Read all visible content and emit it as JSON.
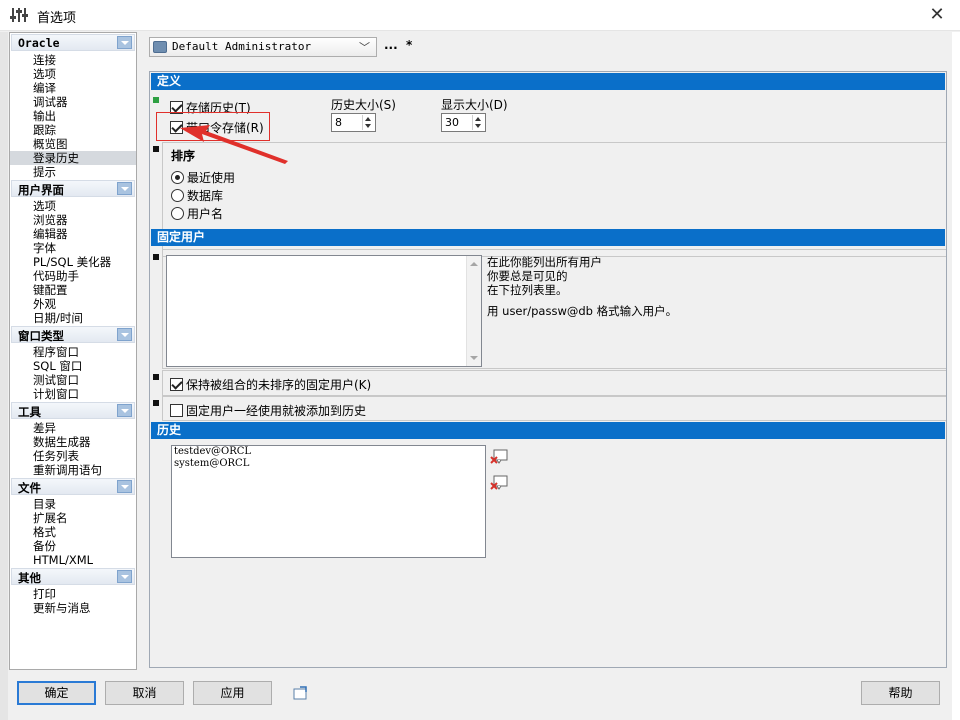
{
  "window": {
    "title": "首选项"
  },
  "sidebar": {
    "groups": [
      {
        "title": "Oracle",
        "items": [
          "连接",
          "选项",
          "编译",
          "调试器",
          "输出",
          "跟踪",
          "概览图",
          "登录历史",
          "提示"
        ]
      },
      {
        "title": "用户界面",
        "items": [
          "选项",
          "浏览器",
          "编辑器",
          "字体",
          "PL/SQL 美化器",
          "代码助手",
          "键配置",
          "外观",
          "日期/时间"
        ]
      },
      {
        "title": "窗口类型",
        "items": [
          "程序窗口",
          "SQL 窗口",
          "测试窗口",
          "计划窗口"
        ]
      },
      {
        "title": "工具",
        "items": [
          "差异",
          "数据生成器",
          "任务列表",
          "重新调用语句"
        ]
      },
      {
        "title": "文件",
        "items": [
          "目录",
          "扩展名",
          "格式",
          "备份",
          "HTML/XML"
        ]
      },
      {
        "title": "其他",
        "items": [
          "打印",
          "更新与消息"
        ]
      }
    ],
    "selected": "登录历史"
  },
  "profile": {
    "value": "Default Administrator",
    "ellipsis": "...",
    "modified": "*"
  },
  "definition": {
    "header": "定义",
    "store_history": {
      "label": "存储历史(T)",
      "checked": true
    },
    "store_password": {
      "label": "带口令存储(R)",
      "checked": true
    },
    "history_size": {
      "label": "历史大小(S)",
      "value": "8"
    },
    "display_size": {
      "label": "显示大小(D)",
      "value": "30"
    },
    "sort": {
      "label": "排序",
      "options": [
        {
          "label": "最近使用",
          "checked": true
        },
        {
          "label": "数据库",
          "checked": false
        },
        {
          "label": "用户名",
          "checked": false
        }
      ]
    }
  },
  "fixed_users": {
    "header": "固定用户",
    "info": [
      "在此你能列出所有用户",
      "你要总是可见的",
      "在下拉列表里。",
      "用 user/passw@db 格式输入用户。"
    ],
    "keep_unsorted": {
      "label": "保持被组合的未排序的固定用户(K)",
      "checked": true
    },
    "add_to_history": {
      "label": "固定用户一经使用就被添加到历史",
      "checked": false
    }
  },
  "history": {
    "header": "历史",
    "items": [
      "testdev@ORCL",
      "system@ORCL"
    ]
  },
  "footer": {
    "ok": "确定",
    "cancel": "取消",
    "apply": "应用",
    "help": "帮助"
  },
  "colors": {
    "section_header": "#0a6fc9",
    "annotation": "#e0302b"
  }
}
